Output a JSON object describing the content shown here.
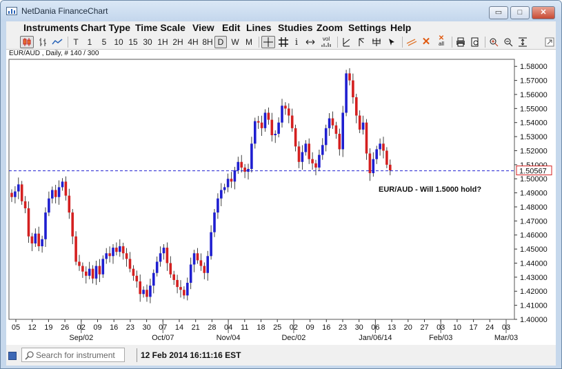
{
  "window": {
    "title": "NetDania FinanceChart",
    "minimize_glyph": "▭",
    "maximize_glyph": "□",
    "close_glyph": "✕"
  },
  "menu": [
    "Instruments",
    "Chart Type",
    "Time Scale",
    "View",
    "Edit",
    "Lines",
    "Studies",
    "Zoom",
    "Settings",
    "Help"
  ],
  "toolbar": {
    "intervals": [
      "T",
      "1",
      "5",
      "10",
      "15",
      "30",
      "1H",
      "2H",
      "4H",
      "8H",
      "D",
      "W",
      "M"
    ],
    "selected_interval": "D",
    "icons": [
      "candlestick-icon",
      "ohlc-bars-icon",
      "line-chart-icon",
      "crosshair-icon",
      "grid-icon",
      "info-icon",
      "pan-icon",
      "volume-icon",
      "trendline-icon",
      "ray-icon",
      "pitchfork-icon",
      "cursor-icon",
      "parallel-lines-icon",
      "delete-icon",
      "delete-all-icon",
      "print-icon",
      "print-preview-icon",
      "zoom-in-icon",
      "zoom-out-icon",
      "fit-icon",
      "detach-icon"
    ],
    "volume_label": "vol",
    "delete_all_label": "all"
  },
  "chart": {
    "instrument_label": "EUR/AUD , Daily, # 140 / 300",
    "annotation": "EUR/AUD - Will 1.5000 hold?",
    "last_price": "1.50567"
  },
  "status": {
    "search_placeholder": "Search for instrument",
    "timestamp": "12 Feb 2014 16:11:16 EST"
  },
  "colors": {
    "up_candle": "#1f1fd0",
    "down_candle": "#d42020",
    "price_line": "#1f1fd0",
    "window_frame": "#c6d8ec",
    "status_square": "#3e68b5"
  },
  "chart_data": {
    "type": "candlestick",
    "title": "",
    "xlabel": "",
    "ylabel": "",
    "ylim": [
      1.4,
      1.585
    ],
    "y_ticks": [
      "1.40000",
      "1.41000",
      "1.42000",
      "1.43000",
      "1.44000",
      "1.45000",
      "1.46000",
      "1.47000",
      "1.48000",
      "1.49000",
      "1.50000",
      "1.51000",
      "1.52000",
      "1.53000",
      "1.54000",
      "1.55000",
      "1.56000",
      "1.57000",
      "1.58000"
    ],
    "x_day_ticks": [
      "05",
      "12",
      "19",
      "26",
      "02",
      "09",
      "16",
      "23",
      "30",
      "07",
      "14",
      "21",
      "28",
      "04",
      "11",
      "18",
      "25",
      "02",
      "09",
      "16",
      "23",
      "30",
      "06",
      "13",
      "20",
      "27",
      "03",
      "10",
      "17",
      "24",
      "03"
    ],
    "x_month_labels": [
      {
        "label": "Sep/02",
        "tick_index": 4
      },
      {
        "label": "Oct/07",
        "tick_index": 9
      },
      {
        "label": "Nov/04",
        "tick_index": 13
      },
      {
        "label": "Dec/02",
        "tick_index": 17
      },
      {
        "label": "Jan/06/14",
        "tick_index": 22
      },
      {
        "label": "Feb/03",
        "tick_index": 26
      },
      {
        "label": "Mar/03",
        "tick_index": 30
      }
    ],
    "reference_price": 1.5057,
    "closes": [
      1.487,
      1.491,
      1.496,
      1.484,
      1.479,
      1.459,
      1.454,
      1.461,
      1.452,
      1.457,
      1.476,
      1.486,
      1.492,
      1.487,
      1.494,
      1.498,
      1.488,
      1.476,
      1.459,
      1.441,
      1.438,
      1.434,
      1.431,
      1.436,
      1.429,
      1.438,
      1.432,
      1.443,
      1.447,
      1.445,
      1.451,
      1.448,
      1.452,
      1.447,
      1.443,
      1.436,
      1.431,
      1.427,
      1.418,
      1.421,
      1.416,
      1.424,
      1.433,
      1.441,
      1.447,
      1.451,
      1.44,
      1.432,
      1.428,
      1.423,
      1.421,
      1.417,
      1.426,
      1.439,
      1.447,
      1.442,
      1.438,
      1.433,
      1.445,
      1.462,
      1.476,
      1.486,
      1.492,
      1.494,
      1.5,
      1.498,
      1.506,
      1.512,
      1.508,
      1.505,
      1.507,
      1.525,
      1.541,
      1.54,
      1.536,
      1.547,
      1.542,
      1.531,
      1.532,
      1.54,
      1.552,
      1.55,
      1.545,
      1.536,
      1.523,
      1.512,
      1.519,
      1.525,
      1.514,
      1.511,
      1.508,
      1.517,
      1.524,
      1.536,
      1.543,
      1.538,
      1.532,
      1.521,
      1.547,
      1.575,
      1.57,
      1.558,
      1.545,
      1.535,
      1.54,
      1.518,
      1.504,
      1.514,
      1.521,
      1.525,
      1.52,
      1.51,
      1.506
    ]
  }
}
